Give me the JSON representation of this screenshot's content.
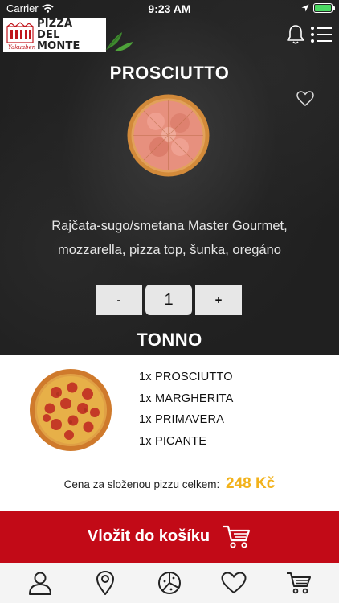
{
  "status_bar": {
    "carrier": "Carrier",
    "time": "9:23 AM"
  },
  "header": {
    "logo_line1": "PIZZA",
    "logo_line2": "DEL MONTE",
    "logo_script": "Yakuaben",
    "icons": [
      "bell-icon",
      "menu-icon"
    ]
  },
  "product": {
    "name": "PROSCIUTTO",
    "description_line1": "Rajčata-sugo/smetana Master Gourmet,",
    "description_line2": "mozzarella, pizza top, šunka, oregáno",
    "quantity": "1",
    "minus_label": "-",
    "plus_label": "+"
  },
  "next_product": {
    "name": "TONNO"
  },
  "summary": {
    "items": [
      "1x PROSCIUTTO",
      "1x MARGHERITA",
      "1x PRIMAVERA",
      "1x PICANTE"
    ],
    "total_label": "Cena za složenou pizzu celkem:",
    "total_price": "248 Kč"
  },
  "cart_button": {
    "label": "Vložit do košíku"
  },
  "tabbar": {
    "tabs": [
      "profile-icon",
      "location-icon",
      "pizza-icon",
      "favorites-icon",
      "cart-icon"
    ]
  },
  "colors": {
    "accent_red": "#c20a17",
    "price_yellow": "#f2b21b",
    "battery_green": "#4cd964"
  }
}
